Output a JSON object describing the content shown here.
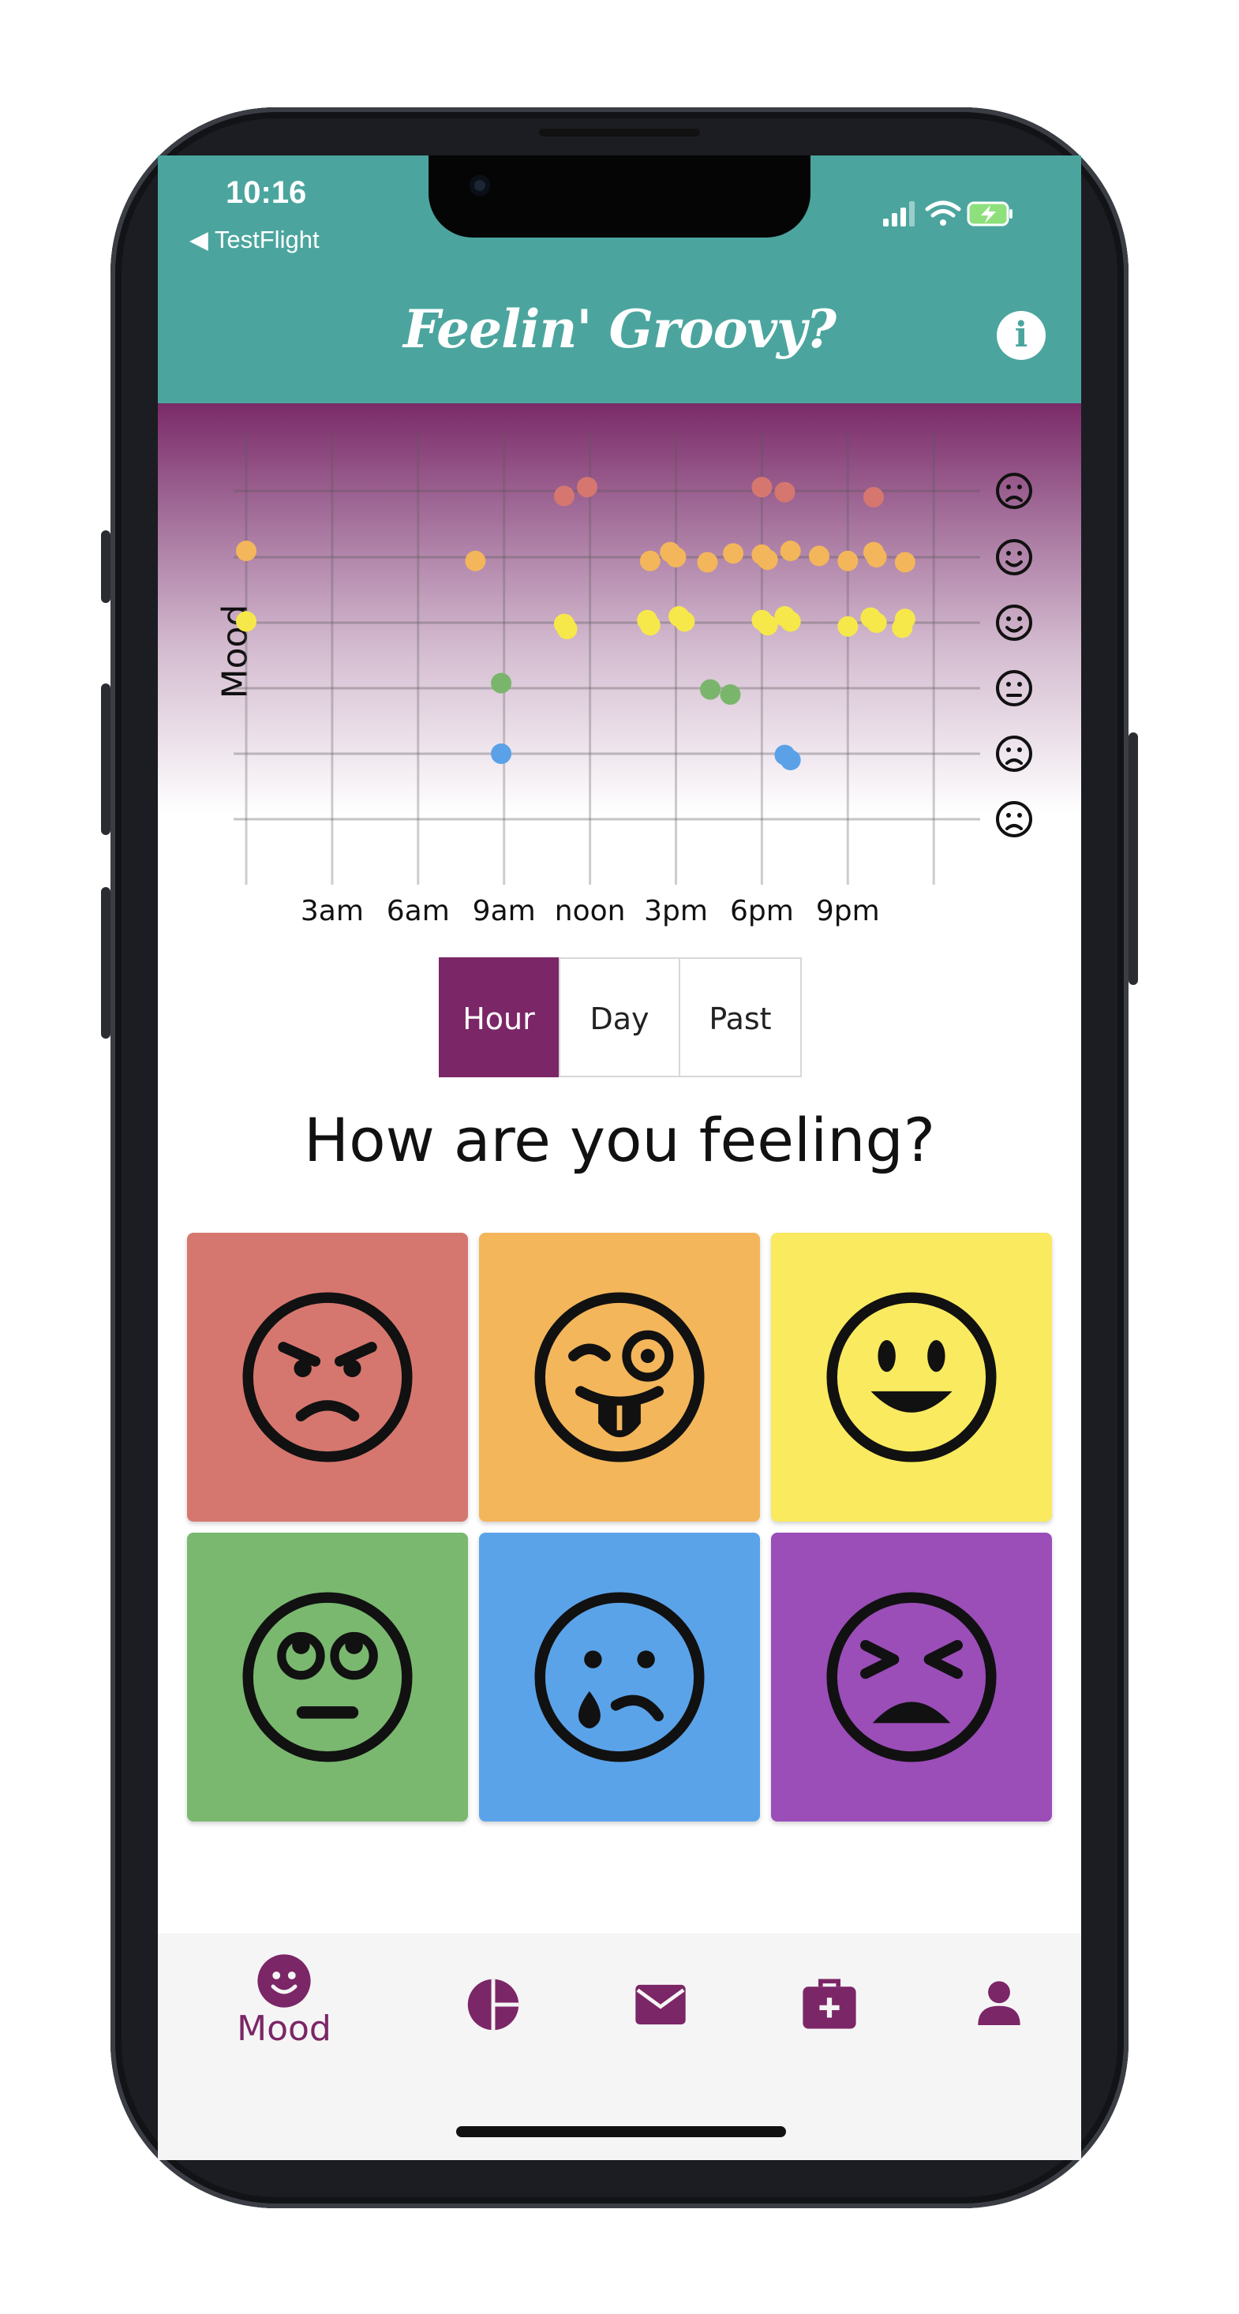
{
  "status_bar": {
    "time": "10:16",
    "back_label": "◀ TestFlight"
  },
  "header": {
    "title": "Feelin' Groovy?",
    "info_icon": "info-icon"
  },
  "chart_data": {
    "type": "scatter",
    "ylabel": "Mood",
    "x_tick_labels": [
      "3am",
      "6am",
      "9am",
      "noon",
      "3pm",
      "6pm",
      "9pm"
    ],
    "y_levels": [
      "angry",
      "silly",
      "happy",
      "meh",
      "sad",
      "miserable"
    ],
    "xlim": [
      0,
      24
    ],
    "grid": true,
    "points": [
      {
        "x": 0.0,
        "mood": "silly"
      },
      {
        "x": 0.0,
        "mood": "happy"
      },
      {
        "x": 8.0,
        "mood": "silly"
      },
      {
        "x": 8.9,
        "mood": "meh"
      },
      {
        "x": 8.9,
        "mood": "sad"
      },
      {
        "x": 11.1,
        "mood": "angry"
      },
      {
        "x": 11.9,
        "mood": "angry"
      },
      {
        "x": 11.1,
        "mood": "happy"
      },
      {
        "x": 11.2,
        "mood": "happy"
      },
      {
        "x": 14.0,
        "mood": "happy"
      },
      {
        "x": 14.1,
        "mood": "happy"
      },
      {
        "x": 15.1,
        "mood": "happy"
      },
      {
        "x": 15.3,
        "mood": "happy"
      },
      {
        "x": 14.1,
        "mood": "silly"
      },
      {
        "x": 14.8,
        "mood": "silly"
      },
      {
        "x": 15.0,
        "mood": "silly"
      },
      {
        "x": 16.1,
        "mood": "silly"
      },
      {
        "x": 17.0,
        "mood": "silly"
      },
      {
        "x": 16.2,
        "mood": "meh"
      },
      {
        "x": 16.9,
        "mood": "meh"
      },
      {
        "x": 18.0,
        "mood": "silly"
      },
      {
        "x": 18.2,
        "mood": "silly"
      },
      {
        "x": 19.0,
        "mood": "silly"
      },
      {
        "x": 20.0,
        "mood": "silly"
      },
      {
        "x": 21.0,
        "mood": "silly"
      },
      {
        "x": 21.9,
        "mood": "silly"
      },
      {
        "x": 22.0,
        "mood": "silly"
      },
      {
        "x": 23.0,
        "mood": "silly"
      },
      {
        "x": 18.0,
        "mood": "angry"
      },
      {
        "x": 18.8,
        "mood": "angry"
      },
      {
        "x": 21.9,
        "mood": "angry"
      },
      {
        "x": 18.0,
        "mood": "happy"
      },
      {
        "x": 18.2,
        "mood": "happy"
      },
      {
        "x": 18.8,
        "mood": "happy"
      },
      {
        "x": 19.0,
        "mood": "happy"
      },
      {
        "x": 21.0,
        "mood": "happy"
      },
      {
        "x": 21.8,
        "mood": "happy"
      },
      {
        "x": 22.0,
        "mood": "happy"
      },
      {
        "x": 22.9,
        "mood": "happy"
      },
      {
        "x": 23.0,
        "mood": "happy"
      },
      {
        "x": 18.8,
        "mood": "sad"
      },
      {
        "x": 19.0,
        "mood": "sad"
      }
    ],
    "mood_colors": {
      "angry": "#d6776f",
      "silly": "#f3b65b",
      "happy": "#f6e84a",
      "meh": "#7ab56c",
      "sad": "#5aa1e8",
      "miserable": "#9a4eb6"
    }
  },
  "segments": [
    {
      "label": "Hour",
      "active": true
    },
    {
      "label": "Day",
      "active": false
    },
    {
      "label": "Past",
      "active": false
    }
  ],
  "question": "How are you feeling?",
  "moods": [
    {
      "name": "angry",
      "color": "#d6776f",
      "icon": "angry-face-icon"
    },
    {
      "name": "silly",
      "color": "#f3b65b",
      "icon": "tongue-wink-face-icon"
    },
    {
      "name": "happy",
      "color": "#f9ea5f",
      "icon": "smile-face-icon"
    },
    {
      "name": "meh",
      "color": "#7ab86f",
      "icon": "eye-roll-face-icon"
    },
    {
      "name": "sad",
      "color": "#5ba3e9",
      "icon": "sad-tear-face-icon"
    },
    {
      "name": "miserable",
      "color": "#9b4db8",
      "icon": "tired-face-icon"
    }
  ],
  "tabbar": {
    "accent": "#7b2667",
    "items": [
      {
        "label": "Mood",
        "icon": "smile-icon",
        "active": true
      },
      {
        "label": "",
        "icon": "pie-chart-icon",
        "active": false
      },
      {
        "label": "",
        "icon": "envelope-icon",
        "active": false
      },
      {
        "label": "",
        "icon": "medkit-icon",
        "active": false
      },
      {
        "label": "",
        "icon": "user-icon",
        "active": false
      }
    ]
  }
}
